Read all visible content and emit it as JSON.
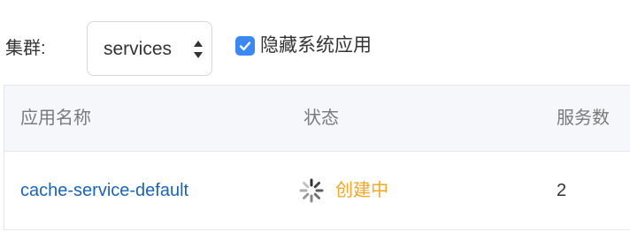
{
  "filter": {
    "cluster_label": "集群:",
    "cluster_value": "services",
    "hide_system_apps_label": "隐藏系统应用",
    "hide_system_apps_checked": true
  },
  "table": {
    "columns": [
      "应用名称",
      "状态",
      "服务数"
    ],
    "rows": [
      {
        "name": "cache-service-default",
        "status": "创建中",
        "status_icon": "loading-spinner-icon",
        "services": "2"
      }
    ]
  },
  "colors": {
    "link": "#1a64b8",
    "status_creating": "#f5a623",
    "checkbox_checked": "#3b88f5",
    "header_bg": "#f5f7fa"
  }
}
